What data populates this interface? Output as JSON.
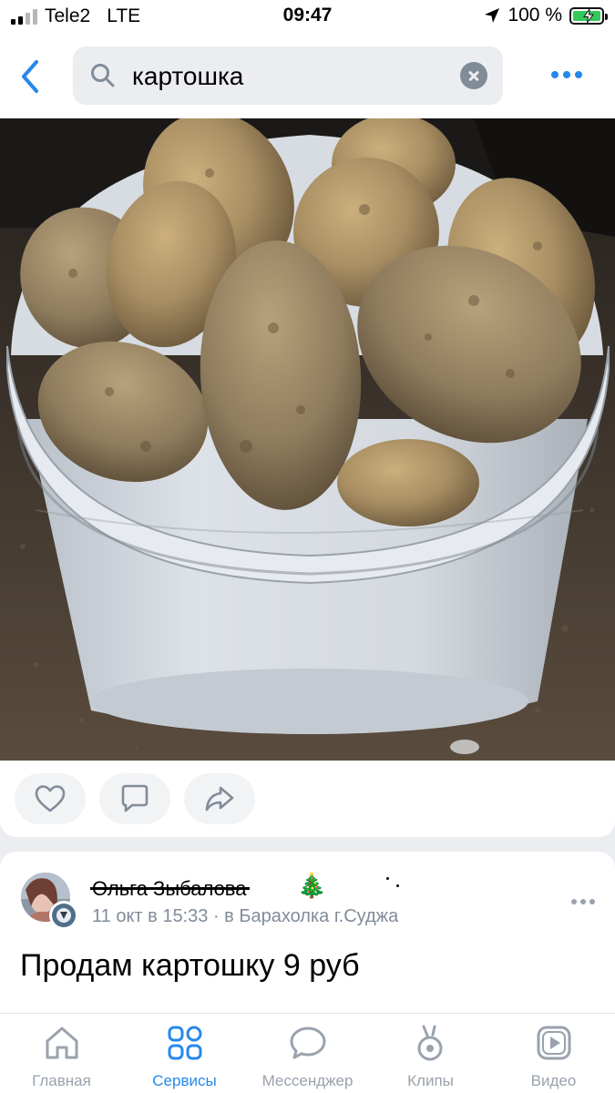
{
  "status_bar": {
    "carrier": "Tele2",
    "network": "LTE",
    "time": "09:47",
    "battery": "100 %"
  },
  "search": {
    "query": "картошка"
  },
  "post": {
    "author": "Ольга Зыбалова",
    "date": "11 окт в 15:33",
    "source": "в Барахолка г.Суджа",
    "text": "Продам картошку 9 руб"
  },
  "tabs": [
    {
      "label": "Главная",
      "icon": "home-icon",
      "active": false
    },
    {
      "label": "Сервисы",
      "icon": "services-icon",
      "active": true
    },
    {
      "label": "Мессенджер",
      "icon": "messenger-icon",
      "active": false
    },
    {
      "label": "Клипы",
      "icon": "clips-icon",
      "active": false
    },
    {
      "label": "Видео",
      "icon": "video-icon",
      "active": false
    }
  ],
  "colors": {
    "accent": "#2688eb",
    "inactive": "#99a2ad",
    "background": "#ebedf0",
    "battery": "#34c759"
  }
}
